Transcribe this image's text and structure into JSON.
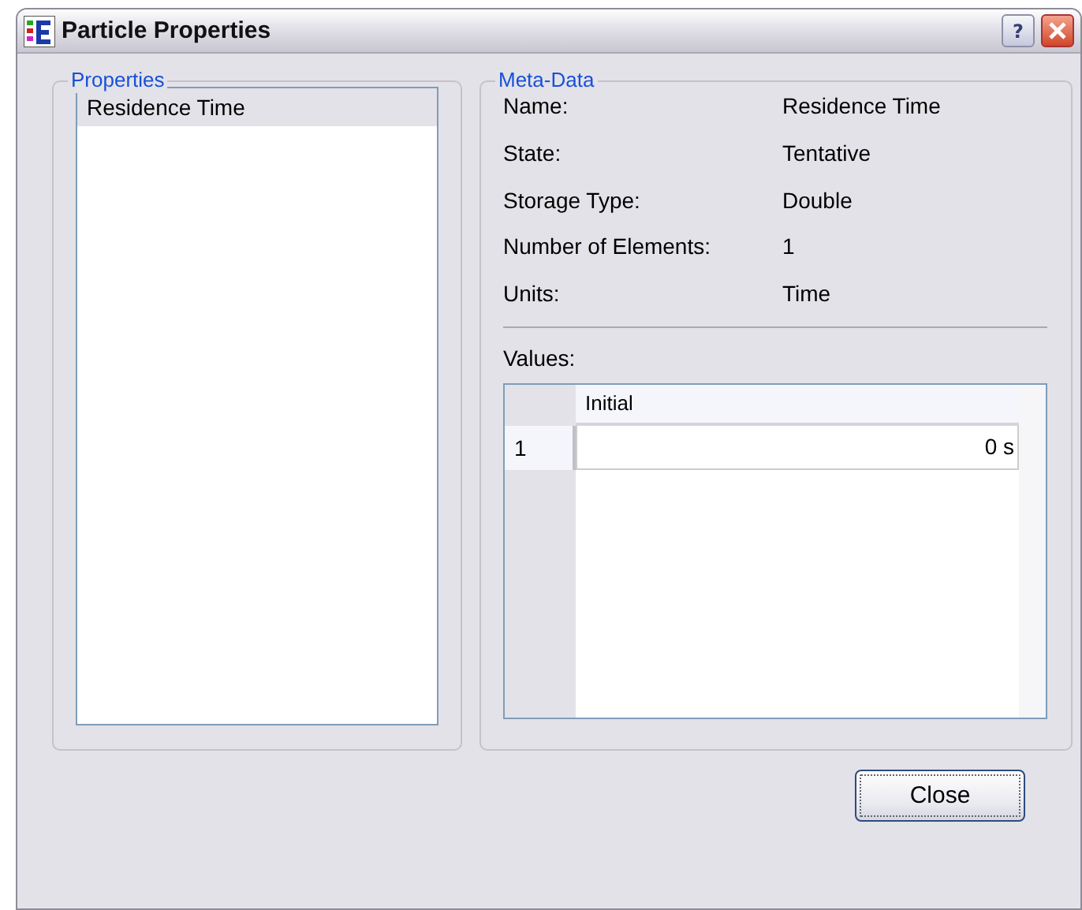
{
  "window": {
    "title": "Particle Properties",
    "help_button": "?"
  },
  "properties": {
    "title": "Properties",
    "items": [
      {
        "label": "Residence Time",
        "selected": true
      }
    ]
  },
  "meta_data": {
    "title": "Meta-Data",
    "fields": [
      {
        "label": "Name:",
        "value": "Residence Time"
      },
      {
        "label": "State:",
        "value": "Tentative"
      },
      {
        "label": "Storage Type:",
        "value": "Double"
      },
      {
        "label": "Number of Elements:",
        "value": "1"
      },
      {
        "label": "Units:",
        "value": "Time"
      }
    ],
    "values_label": "Values:",
    "values_table": {
      "columns": [
        "Initial"
      ],
      "rows": [
        {
          "header": "1",
          "cells": [
            "0 s"
          ]
        }
      ]
    }
  },
  "buttons": [
    "Close"
  ]
}
